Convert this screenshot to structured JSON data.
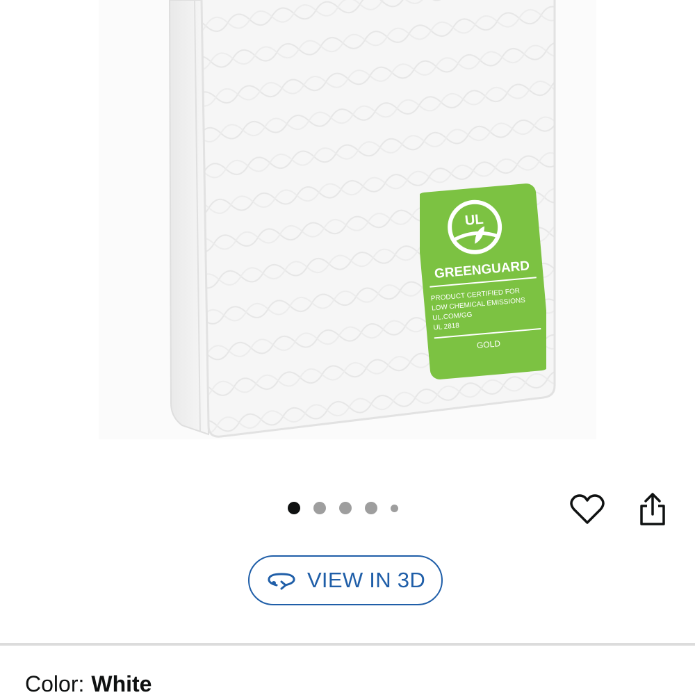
{
  "product_image": {
    "alt": "White crib mattress",
    "badge": {
      "logo_text": "UL",
      "title": "GREENGUARD",
      "lines": [
        "PRODUCT CERTIFIED FOR",
        "LOW CHEMICAL EMISSIONS",
        "UL.COM/GG",
        "UL 2818"
      ],
      "tier": "GOLD",
      "color": "#7cc242"
    }
  },
  "carousel": {
    "total_dots": 5,
    "active_index": 0
  },
  "actions": {
    "wishlist_icon": "heart-outline-icon",
    "share_icon": "share-icon"
  },
  "view3d": {
    "label": "VIEW IN 3D",
    "icon": "rotate-3d-icon",
    "color": "#1f5ea8"
  },
  "variation": {
    "label": "Color:",
    "value": "White"
  }
}
